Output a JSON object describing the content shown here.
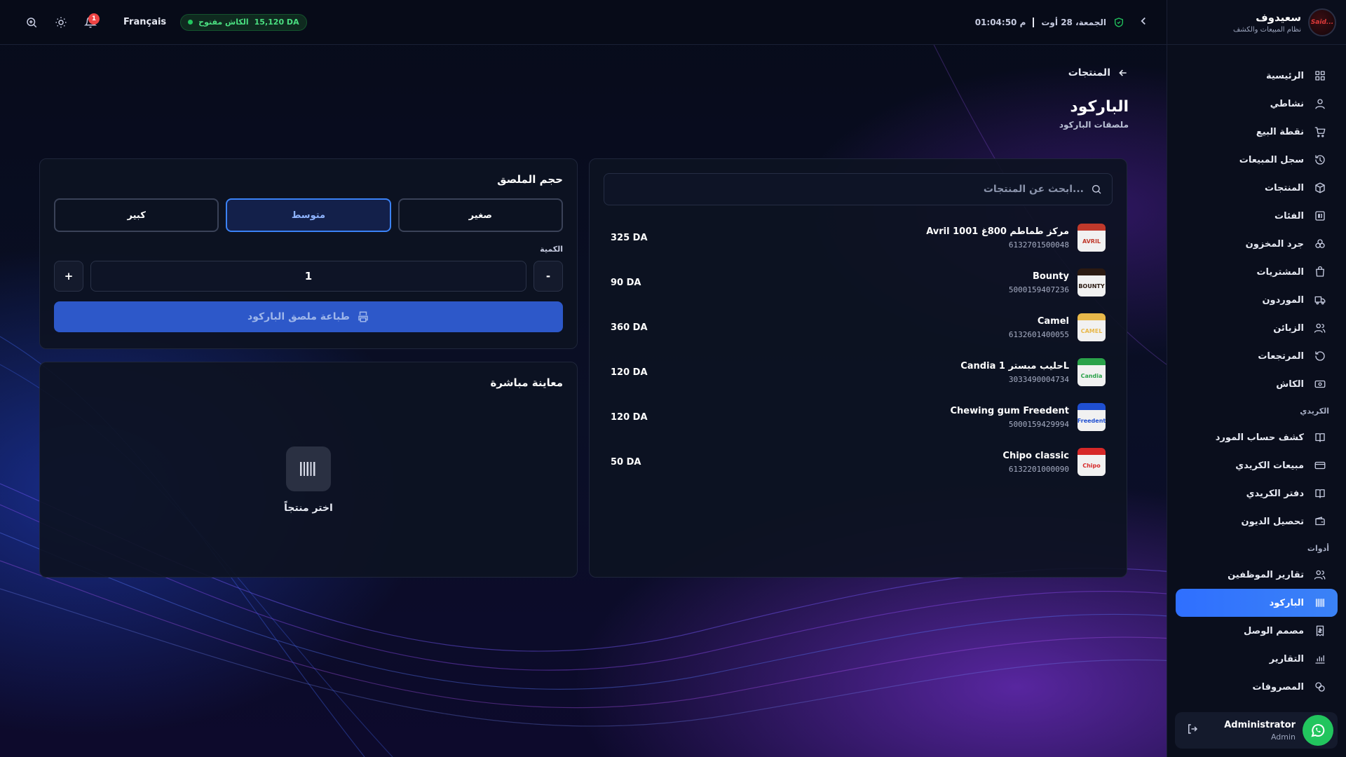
{
  "brand": {
    "name": "سعيدوف",
    "subtitle": "نظام المبيعات والكشف",
    "logo_text": "Said..."
  },
  "topbar": {
    "notification_count": "1",
    "language": "Français",
    "cash_status": "الكاش مفتوح",
    "cash_amount": "15,120 DA",
    "date": "الجمعة، 28 أوت",
    "time": "01:04:50 م"
  },
  "nav": {
    "items": [
      {
        "label": "الرئيسية",
        "icon": "grid-icon"
      },
      {
        "label": "نشاطي",
        "icon": "user-icon"
      },
      {
        "label": "نقطة البيع",
        "icon": "cart-icon"
      },
      {
        "label": "سجل المبيعات",
        "icon": "history-icon"
      },
      {
        "label": "المنتجات",
        "icon": "box-icon"
      },
      {
        "label": "الفئات",
        "icon": "category-icon"
      },
      {
        "label": "جرد المخزون",
        "icon": "stock-icon"
      },
      {
        "label": "المشتريات",
        "icon": "bag-icon"
      },
      {
        "label": "الموردون",
        "icon": "truck-icon"
      },
      {
        "label": "الزبائن",
        "icon": "users-icon"
      },
      {
        "label": "المرتجعات",
        "icon": "return-icon"
      },
      {
        "label": "الكاش",
        "icon": "cash-icon"
      }
    ],
    "section_credit": "الكريدي",
    "credit_items": [
      {
        "label": "كشف حساب المورد",
        "icon": "book-icon"
      },
      {
        "label": "مبيعات الكريدي",
        "icon": "card-icon"
      },
      {
        "label": "دفتر الكريدي",
        "icon": "book-icon"
      },
      {
        "label": "تحصيل الديون",
        "icon": "wallet-icon"
      }
    ],
    "section_tools": "أدوات",
    "tool_items": [
      {
        "label": "تقارير الموظفين",
        "icon": "users-icon"
      },
      {
        "label": "الباركود",
        "icon": "barcode-icon",
        "active": true
      },
      {
        "label": "مصمم الوصل",
        "icon": "receipt-icon"
      },
      {
        "label": "التقارير",
        "icon": "chart-icon"
      },
      {
        "label": "المصروفات",
        "icon": "coins-icon"
      }
    ]
  },
  "user": {
    "name": "Administrator",
    "role": "Admin"
  },
  "page": {
    "breadcrumb": "المنتجات",
    "title": "الباركود",
    "subtitle": "ملصقات الباركود"
  },
  "search": {
    "placeholder": "ابحث عن المنتجات..."
  },
  "products": [
    {
      "name": "Avril 1001 مركز طماطم 800غ",
      "code": "6132701500048",
      "price": "325 DA",
      "thumb_color": "#c0392b",
      "thumb_text": "AVRIL"
    },
    {
      "name": "Bounty",
      "code": "5000159407236",
      "price": "90 DA",
      "thumb_color": "#2b1a12",
      "thumb_text": "BOUNTY"
    },
    {
      "name": "Camel",
      "code": "6132601400055",
      "price": "360 DA",
      "thumb_color": "#e8b84a",
      "thumb_text": "CAMEL"
    },
    {
      "name": "Candia حليب مبستر 1L",
      "code": "3033490004734",
      "price": "120 DA",
      "thumb_color": "#2aa24a",
      "thumb_text": "Candia"
    },
    {
      "name": "Chewing gum Freedent",
      "code": "5000159429994",
      "price": "120 DA",
      "thumb_color": "#1f4fd1",
      "thumb_text": "Freedent"
    },
    {
      "name": "Chipo classic",
      "code": "6132201000090",
      "price": "50 DA",
      "thumb_color": "#d62828",
      "thumb_text": "Chipo"
    }
  ],
  "label_size": {
    "title": "حجم الملصق",
    "options": [
      "صغير",
      "متوسط",
      "كبير"
    ],
    "selected": "متوسط",
    "quantity_label": "الكمية",
    "quantity": "1",
    "minus": "-",
    "plus": "+",
    "print_label": "طباعة ملصق الباركود"
  },
  "preview": {
    "title": "معاينة مباشرة",
    "hint": "اختر منتجاً"
  }
}
